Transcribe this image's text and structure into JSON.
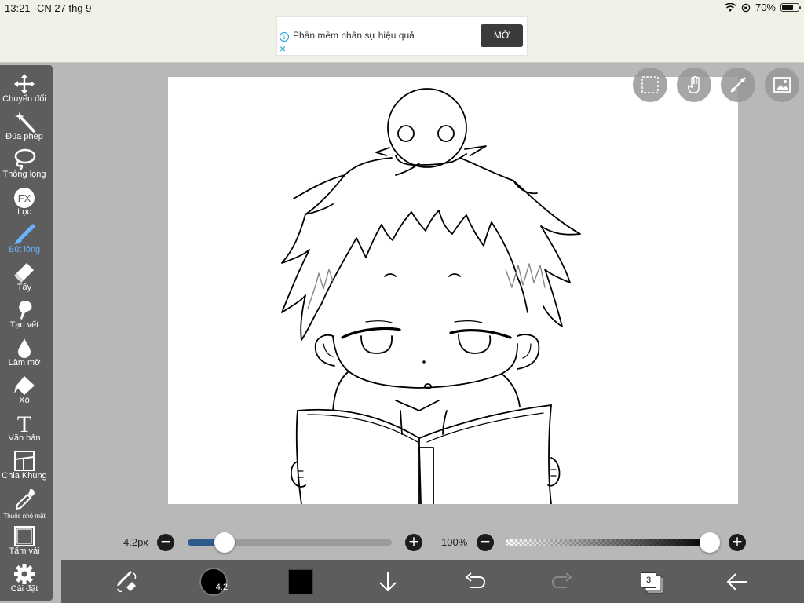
{
  "status": {
    "time": "13:21",
    "date": "CN 27 thg 9",
    "battery": "70%"
  },
  "ad": {
    "text": "Phần mềm nhân sự hiệu quả",
    "button": "MỞ",
    "info_icon": "i",
    "close_icon": "×"
  },
  "toolbar": {
    "items": [
      {
        "label": "Chuyển đổi",
        "icon": "move-icon"
      },
      {
        "label": "Đũa phép",
        "icon": "magic-wand-icon"
      },
      {
        "label": "Thòng lọng",
        "icon": "lasso-icon"
      },
      {
        "label": "Lọc",
        "icon": "fx-icon"
      },
      {
        "label": "Bút lông",
        "icon": "brush-icon"
      },
      {
        "label": "Tẩy",
        "icon": "eraser-icon"
      },
      {
        "label": "Tạo vết",
        "icon": "smudge-icon"
      },
      {
        "label": "Làm mờ",
        "icon": "blur-icon"
      },
      {
        "label": "Xô",
        "icon": "bucket-icon"
      },
      {
        "label": "Văn bản",
        "icon": "text-icon"
      },
      {
        "label": "Chia Khung",
        "icon": "frame-divider-icon"
      },
      {
        "label": "Thuốc nhỏ mắt",
        "icon": "eyedropper-icon"
      },
      {
        "label": "Tấm vải",
        "icon": "canvas-icon"
      },
      {
        "label": "Cài đặt",
        "icon": "gear-icon"
      }
    ],
    "active": "Bút lông",
    "active_color": "#6ab4ff",
    "fx_text": "FX",
    "text_glyph": "T"
  },
  "brush": {
    "size_label": "4.2px",
    "size_fraction": 0.14,
    "preview_label": "4.2"
  },
  "opacity": {
    "label": "100%",
    "value": 1.0
  },
  "controls": {
    "minus": "−",
    "plus": "+"
  },
  "layers": {
    "count": "3"
  },
  "colors": {
    "current": "#000000",
    "accent": "#2f5b8c"
  }
}
